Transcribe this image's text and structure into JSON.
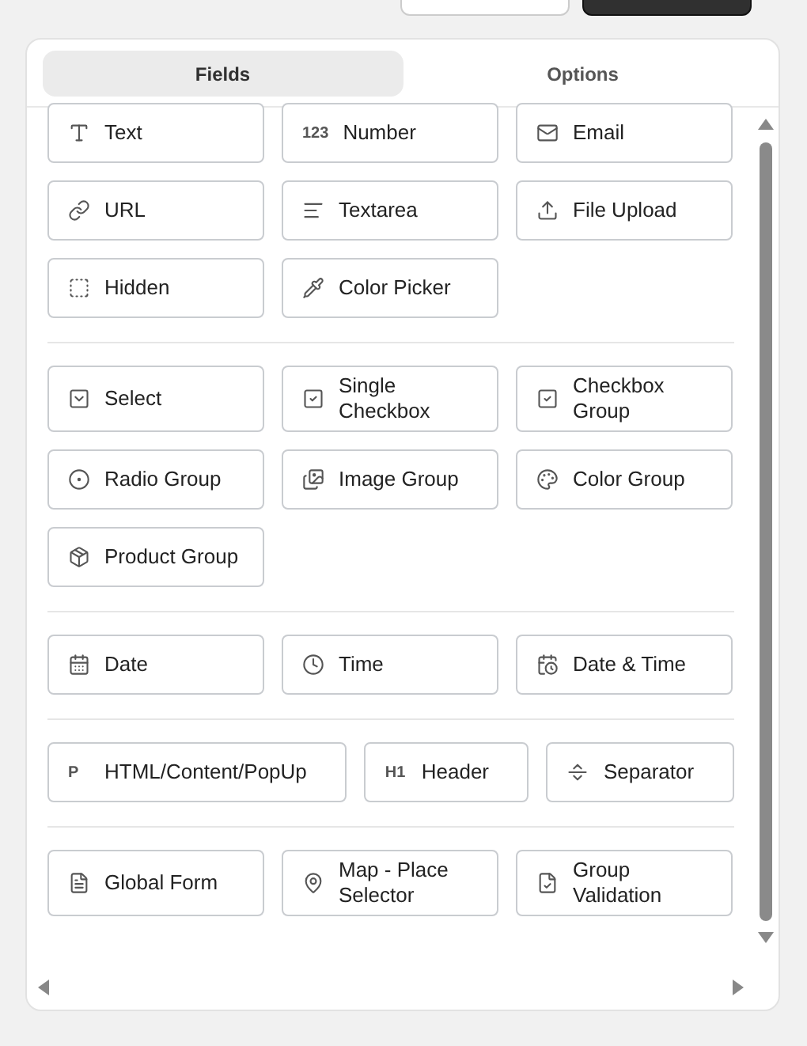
{
  "top_buttons": [
    {
      "kind": "secondary"
    },
    {
      "kind": "primary"
    }
  ],
  "tabs": [
    {
      "label": "Fields",
      "selected": true
    },
    {
      "label": "Options",
      "selected": false
    }
  ],
  "groups": [
    {
      "kind": "grid",
      "fields": [
        {
          "kind": "text",
          "label": "Text"
        },
        {
          "kind": "number",
          "glyph": "123",
          "label": "Number"
        },
        {
          "kind": "email",
          "label": "Email"
        },
        {
          "kind": "url",
          "label": "URL"
        },
        {
          "kind": "textarea",
          "label": "Textarea"
        },
        {
          "kind": "upload",
          "label": "File Upload"
        },
        {
          "kind": "hidden",
          "label": "Hidden"
        },
        {
          "kind": "color",
          "label": "Color Picker"
        }
      ]
    },
    {
      "kind": "grid",
      "fields": [
        {
          "kind": "select",
          "label": "Select"
        },
        {
          "kind": "checkbox",
          "label": "Single Checkbox"
        },
        {
          "kind": "checkbox",
          "label": "Checkbox Group"
        },
        {
          "kind": "radio",
          "label": "Radio Group"
        },
        {
          "kind": "image",
          "label": "Image Group"
        },
        {
          "kind": "palette",
          "label": "Color Group"
        },
        {
          "kind": "product",
          "label": "Product Group"
        }
      ]
    },
    {
      "kind": "grid",
      "fields": [
        {
          "kind": "date",
          "label": "Date"
        },
        {
          "kind": "time",
          "label": "Time"
        },
        {
          "kind": "datetime",
          "label": "Date & Time"
        }
      ]
    },
    {
      "kind": "row",
      "fields": [
        {
          "kind": "html",
          "glyph": "P",
          "label": "HTML/Content/PopUp"
        },
        {
          "kind": "header",
          "glyph": "H1",
          "label": "Header"
        },
        {
          "kind": "separator",
          "label": "Separator"
        }
      ]
    },
    {
      "kind": "grid",
      "fields": [
        {
          "kind": "form",
          "label": "Global Form"
        },
        {
          "kind": "map",
          "label": "Map - Place Selector"
        },
        {
          "kind": "validation",
          "label": "Group Validation"
        }
      ]
    }
  ]
}
